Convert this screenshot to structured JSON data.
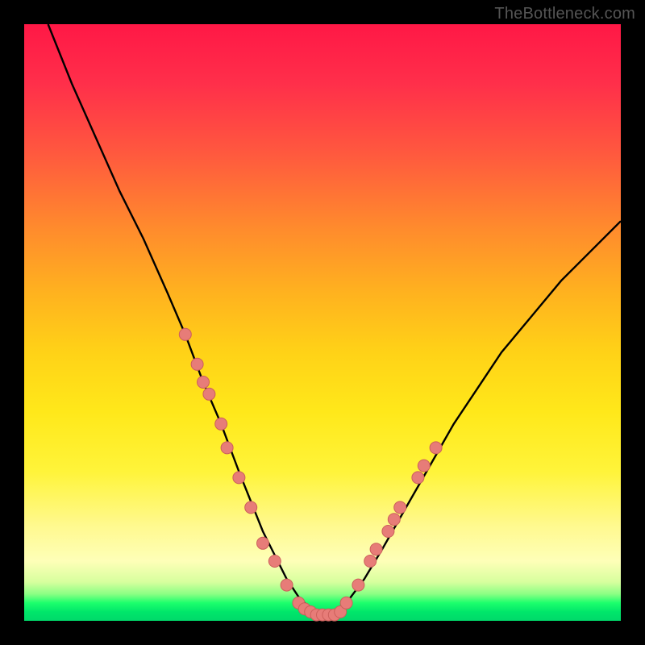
{
  "watermark": "TheBottleneck.com",
  "colors": {
    "frame": "#000000",
    "curve": "#000000",
    "marker_fill": "#e77c78",
    "marker_stroke": "#cc5f5b"
  },
  "chart_data": {
    "type": "line",
    "title": "",
    "xlabel": "",
    "ylabel": "",
    "xlim": [
      0,
      100
    ],
    "ylim": [
      0,
      100
    ],
    "grid": false,
    "legend": false,
    "series": [
      {
        "name": "bottleneck-curve",
        "x": [
          4,
          8,
          12,
          16,
          20,
          24,
          27,
          30,
          33,
          36,
          38,
          40,
          42,
          44,
          46,
          48,
          50,
          52,
          54,
          57,
          60,
          64,
          68,
          72,
          76,
          80,
          85,
          90,
          95,
          100
        ],
        "y": [
          100,
          90,
          81,
          72,
          64,
          55,
          48,
          40,
          33,
          25,
          20,
          15,
          11,
          7,
          4,
          2,
          1,
          1,
          3,
          7,
          12,
          19,
          26,
          33,
          39,
          45,
          51,
          57,
          62,
          67
        ]
      }
    ],
    "markers": [
      {
        "x": 27,
        "y": 48
      },
      {
        "x": 29,
        "y": 43
      },
      {
        "x": 30,
        "y": 40
      },
      {
        "x": 31,
        "y": 38
      },
      {
        "x": 33,
        "y": 33
      },
      {
        "x": 34,
        "y": 29
      },
      {
        "x": 36,
        "y": 24
      },
      {
        "x": 38,
        "y": 19
      },
      {
        "x": 40,
        "y": 13
      },
      {
        "x": 42,
        "y": 10
      },
      {
        "x": 44,
        "y": 6
      },
      {
        "x": 46,
        "y": 3
      },
      {
        "x": 47,
        "y": 2
      },
      {
        "x": 48,
        "y": 1.5
      },
      {
        "x": 49,
        "y": 1
      },
      {
        "x": 50,
        "y": 1
      },
      {
        "x": 51,
        "y": 1
      },
      {
        "x": 52,
        "y": 1
      },
      {
        "x": 53,
        "y": 1.5
      },
      {
        "x": 54,
        "y": 3
      },
      {
        "x": 56,
        "y": 6
      },
      {
        "x": 58,
        "y": 10
      },
      {
        "x": 59,
        "y": 12
      },
      {
        "x": 61,
        "y": 15
      },
      {
        "x": 62,
        "y": 17
      },
      {
        "x": 63,
        "y": 19
      },
      {
        "x": 66,
        "y": 24
      },
      {
        "x": 67,
        "y": 26
      },
      {
        "x": 69,
        "y": 29
      }
    ]
  }
}
